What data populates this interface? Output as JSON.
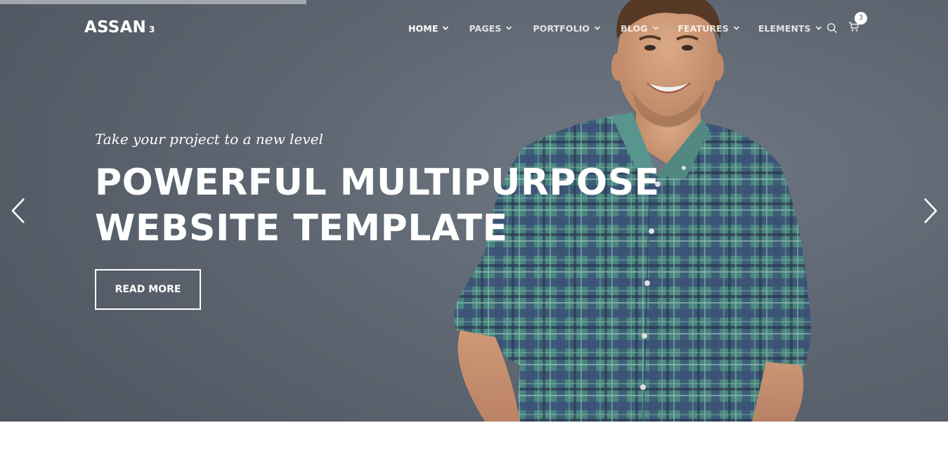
{
  "brand": {
    "name": "ASSAN",
    "version": "3"
  },
  "nav": {
    "items": [
      {
        "label": "HOME",
        "active": true
      },
      {
        "label": "PAGES",
        "active": false
      },
      {
        "label": "PORTFOLIO",
        "active": false
      },
      {
        "label": "BLOG",
        "active": false
      },
      {
        "label": "FEATURES",
        "active": false
      },
      {
        "label": "ELEMENTS",
        "active": false
      }
    ],
    "cart_count": "3",
    "icons": [
      "search-icon",
      "cart-icon",
      "chevron-down-icon"
    ]
  },
  "hero": {
    "tagline": "Take your project to a new level",
    "headline_line1": "POWERFUL MULTIPURPOSE",
    "headline_line2": "WEBSITE TEMPLATE",
    "cta_label": "READ MORE",
    "arrows": [
      "chevron-left-icon",
      "chevron-right-icon"
    ]
  },
  "colors": {
    "wall": "#646c77",
    "text": "#ffffff",
    "shirt_green": "#4f8f86",
    "shirt_blue": "#3b4f78"
  }
}
